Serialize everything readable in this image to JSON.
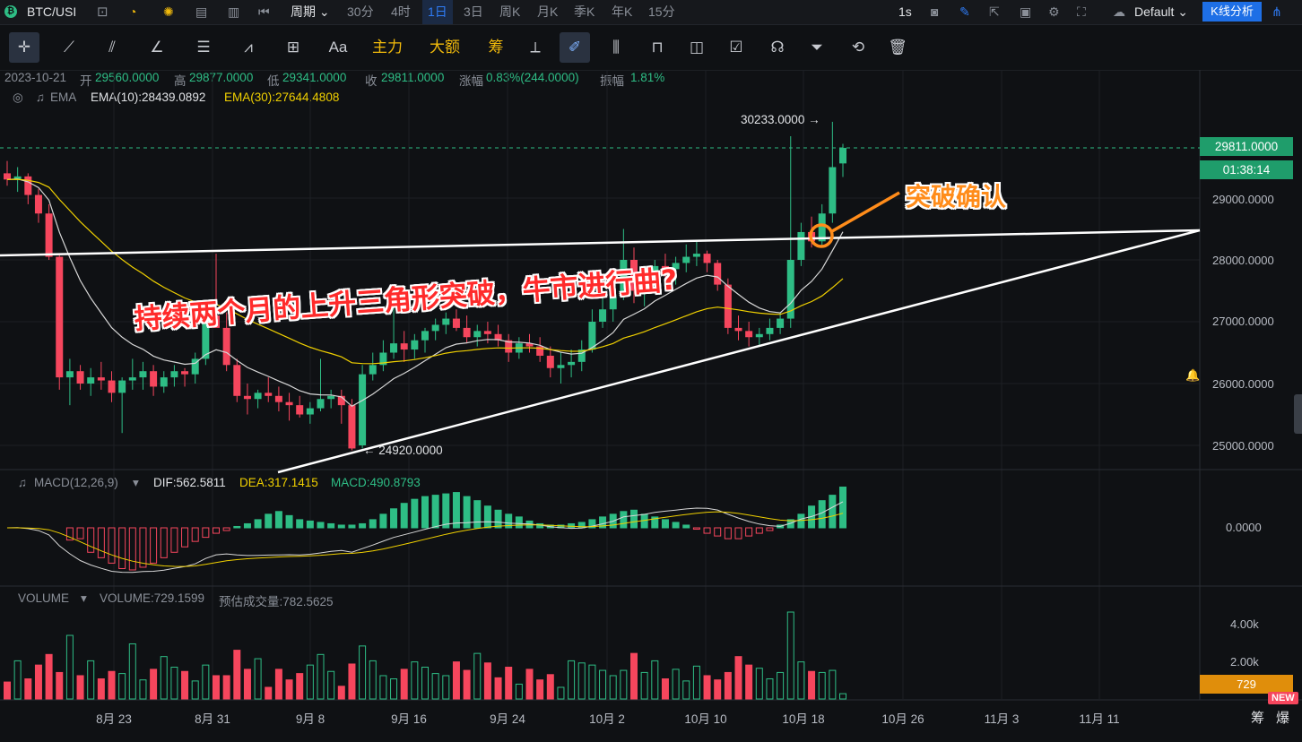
{
  "header": {
    "symbol": "BTC/USI",
    "period_label": "周期",
    "intervals": [
      "30分",
      "4时",
      "1日",
      "3日",
      "周K",
      "月K",
      "季K",
      "年K",
      "15分"
    ],
    "active_interval": "1日",
    "refresh": "1s",
    "layout_name": "Default",
    "kline_button": "K线分析"
  },
  "drawing_toolbar": {
    "font_label": "Aa",
    "buttons": [
      "主力",
      "大额",
      "筹"
    ]
  },
  "ohlc": {
    "date": "2023-10-21",
    "open_label": "开",
    "open": "29560.0000",
    "high_label": "高",
    "high": "29877.0000",
    "low_label": "低",
    "low": "29341.0000",
    "close_label": "收",
    "close": "29811.0000",
    "change_label": "涨幅",
    "change": "0.83%(244.0000)",
    "amp_label": "振幅",
    "amp": "1.81%"
  },
  "ema": {
    "name": "EMA",
    "ema10": "EMA(10):28439.0892",
    "ema30": "EMA(30):27644.4808"
  },
  "macd": {
    "name": "MACD(12,26,9)",
    "dif": "DIF:562.5811",
    "dea": "DEA:317.1415",
    "macd": "MACD:490.8793",
    "zero_label": "0.0000"
  },
  "volume": {
    "name": "VOLUME",
    "value": "VOLUME:729.1599",
    "estimate": "预估成交量:782.5625",
    "ticks": [
      "4.00k",
      "2.00k"
    ],
    "badge": "729"
  },
  "price_axis": [
    "29000.0000",
    "28000.0000",
    "27000.0000",
    "26000.0000",
    "25000.0000"
  ],
  "current_price": "29811.0000",
  "countdown": "01:38:14",
  "high_marker": "30233.0000",
  "low_marker": "24920.0000",
  "date_axis": [
    "8月 23",
    "8月 31",
    "9月 8",
    "9月 16",
    "9月 24",
    "10月 2",
    "10月 10",
    "10月 18",
    "10月 26",
    "11月 3",
    "11月 11"
  ],
  "annotations": {
    "headline": "持续两个月的上升三角形突破，牛市进行曲?",
    "breakout": "突破确认"
  },
  "footer": {
    "chips": "筹",
    "burst": "爆",
    "new_tag": "NEW"
  },
  "colors": {
    "up": "#2ebd85",
    "down": "#f6465d",
    "ema10": "#d8d8d8",
    "ema30": "#f0d000",
    "accent": "#2f7cf6",
    "annotation_text": "#ff2b2b",
    "breakout_text": "#ff8c1a"
  },
  "chart_data": {
    "type": "candlestick",
    "y_range": [
      24500,
      30500
    ],
    "candles": [
      [
        29400,
        29600,
        29200,
        29300
      ],
      [
        29300,
        29500,
        29100,
        29350
      ],
      [
        29350,
        29400,
        28900,
        29050
      ],
      [
        29050,
        29150,
        28600,
        28750
      ],
      [
        28750,
        28900,
        28000,
        28050
      ],
      [
        28050,
        28100,
        25900,
        26100
      ],
      [
        26100,
        26400,
        25650,
        26200
      ],
      [
        26200,
        26300,
        25900,
        26000
      ],
      [
        26000,
        26250,
        25800,
        26100
      ],
      [
        26100,
        26350,
        25900,
        26050
      ],
      [
        26050,
        26200,
        25700,
        25850
      ],
      [
        25850,
        26100,
        25200,
        26050
      ],
      [
        26050,
        26400,
        25900,
        26100
      ],
      [
        26100,
        26350,
        25900,
        26200
      ],
      [
        26200,
        26300,
        25800,
        25950
      ],
      [
        25950,
        26200,
        25850,
        26100
      ],
      [
        26100,
        26300,
        25950,
        26200
      ],
      [
        26200,
        26250,
        25950,
        26150
      ],
      [
        26150,
        26500,
        26000,
        26400
      ],
      [
        26400,
        27200,
        26300,
        27100
      ],
      [
        27100,
        28100,
        26950,
        26900
      ],
      [
        26900,
        27150,
        26200,
        26300
      ],
      [
        26300,
        26400,
        25700,
        25800
      ],
      [
        25800,
        26000,
        25500,
        25750
      ],
      [
        25750,
        25900,
        25600,
        25850
      ],
      [
        25850,
        26100,
        25700,
        25800
      ],
      [
        25800,
        25950,
        25550,
        25700
      ],
      [
        25700,
        25850,
        25400,
        25650
      ],
      [
        25650,
        25800,
        25450,
        25500
      ],
      [
        25500,
        25700,
        25350,
        25600
      ],
      [
        25600,
        26400,
        25550,
        25750
      ],
      [
        25750,
        25900,
        25600,
        25800
      ],
      [
        25800,
        25900,
        25350,
        25650
      ],
      [
        25650,
        25750,
        24920,
        24950
      ],
      [
        25000,
        26300,
        24950,
        26150
      ],
      [
        26150,
        26500,
        26050,
        26300
      ],
      [
        26300,
        26700,
        26200,
        26500
      ],
      [
        26500,
        27400,
        26400,
        26650
      ],
      [
        26650,
        26850,
        26350,
        26550
      ],
      [
        26550,
        26800,
        26400,
        26700
      ],
      [
        26700,
        26900,
        26500,
        26850
      ],
      [
        26850,
        27050,
        26700,
        26950
      ],
      [
        26950,
        27150,
        26800,
        27050
      ],
      [
        27050,
        27200,
        26850,
        26900
      ],
      [
        26900,
        27100,
        26650,
        26750
      ],
      [
        26750,
        26950,
        26600,
        26850
      ],
      [
        26850,
        27000,
        26650,
        26800
      ],
      [
        26800,
        26950,
        26600,
        26700
      ],
      [
        26700,
        26800,
        26350,
        26500
      ],
      [
        26500,
        26750,
        26400,
        26650
      ],
      [
        26650,
        26800,
        26500,
        26600
      ],
      [
        26600,
        26750,
        26350,
        26450
      ],
      [
        26450,
        26600,
        26100,
        26250
      ],
      [
        26250,
        26500,
        26000,
        26300
      ],
      [
        26300,
        26550,
        26100,
        26350
      ],
      [
        26350,
        26700,
        26200,
        26550
      ],
      [
        26550,
        27200,
        26500,
        27000
      ],
      [
        27000,
        27400,
        26900,
        27200
      ],
      [
        27200,
        27500,
        27000,
        27400
      ],
      [
        27400,
        28500,
        27350,
        28000
      ],
      [
        28000,
        28200,
        27300,
        27500
      ],
      [
        27500,
        27700,
        27250,
        27600
      ],
      [
        27600,
        28000,
        27500,
        27900
      ],
      [
        27900,
        28100,
        27700,
        27850
      ],
      [
        27850,
        28050,
        27600,
        27950
      ],
      [
        27950,
        28250,
        27800,
        28050
      ],
      [
        28050,
        28300,
        27900,
        28100
      ],
      [
        28100,
        28150,
        27800,
        27950
      ],
      [
        27950,
        28000,
        27500,
        27600
      ],
      [
        27600,
        27700,
        26800,
        26900
      ],
      [
        26900,
        27100,
        26700,
        26850
      ],
      [
        26850,
        27000,
        26600,
        26750
      ],
      [
        26750,
        26900,
        26600,
        26800
      ],
      [
        26800,
        27050,
        26700,
        26900
      ],
      [
        26900,
        27150,
        26800,
        27050
      ],
      [
        27050,
        30000,
        26900,
        28000
      ],
      [
        28000,
        28600,
        27900,
        28450
      ],
      [
        28450,
        28700,
        28200,
        28300
      ],
      [
        28300,
        28900,
        28200,
        28750
      ],
      [
        28750,
        30233,
        28600,
        29500
      ],
      [
        29560,
        29877,
        29341,
        29811
      ]
    ],
    "volume": [
      80,
      180,
      95,
      160,
      210,
      125,
      300,
      110,
      180,
      95,
      130,
      120,
      260,
      90,
      140,
      200,
      150,
      130,
      85,
      160,
      110,
      110,
      230,
      140,
      190,
      55,
      140,
      90,
      120,
      160,
      210,
      130,
      60,
      165,
      250,
      180,
      110,
      95,
      140,
      175,
      150,
      120,
      110,
      175,
      135,
      215,
      170,
      100,
      150,
      70,
      140,
      90,
      115,
      55,
      180,
      170,
      160,
      135,
      110,
      135,
      215,
      125,
      180,
      95,
      140,
      85,
      155,
      110,
      90,
      125,
      200,
      160,
      145,
      95,
      125,
      410,
      175,
      130,
      125,
      135,
      25
    ],
    "macd_hist": [
      -90,
      -80,
      -180,
      -220,
      -260,
      -300,
      -310,
      -290,
      -260,
      -220,
      -180,
      -140,
      -100,
      -70,
      -40,
      -20,
      10,
      30,
      60,
      100,
      120,
      90,
      60,
      50,
      40,
      30,
      20,
      20,
      30,
      60,
      100,
      140,
      180,
      210,
      230,
      240,
      250,
      260,
      230,
      200,
      160,
      130,
      100,
      80,
      50,
      30,
      20,
      20,
      30,
      40,
      60,
      80,
      100,
      120,
      130,
      100,
      80,
      60,
      40,
      20,
      -10,
      -40,
      -60,
      -80,
      -80,
      -60,
      -40,
      -20,
      20,
      60,
      100,
      160,
      200,
      240,
      300
    ],
    "ema10_label": "EMA(10):28439.0892",
    "ema30_label": "EMA(30):27644.4808"
  }
}
